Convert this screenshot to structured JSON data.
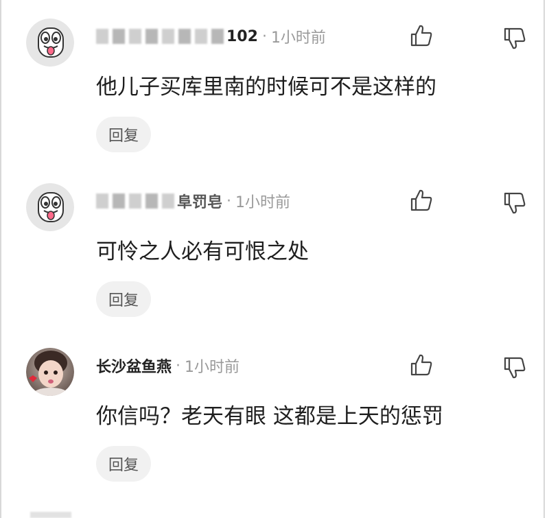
{
  "comments": [
    {
      "username_visible": "102",
      "time": "1小时前",
      "text": "他儿子买库里南的时候可不是这样的",
      "reply_label": "回复"
    },
    {
      "username_visible": "阜罚皂",
      "time": "1小时前",
      "text": "可怜之人必有可恨之处",
      "reply_label": "回复"
    },
    {
      "username_visible": "长沙盆鱼燕",
      "time": "1小时前",
      "text": "你信吗？老天有眼 这都是上天的惩罚",
      "reply_label": "回复"
    }
  ],
  "separator": "·",
  "icons": {
    "like": "thumbs-up-icon",
    "dislike": "thumbs-down-icon",
    "avatar_cartoon": "cartoon-tongue-avatar",
    "avatar_photo": "girl-photo-avatar"
  },
  "colors": {
    "text": "#1e1e1e",
    "muted": "#999999",
    "reply_bg": "#f1f1f1",
    "avatar_ring": "#4cc38a"
  }
}
